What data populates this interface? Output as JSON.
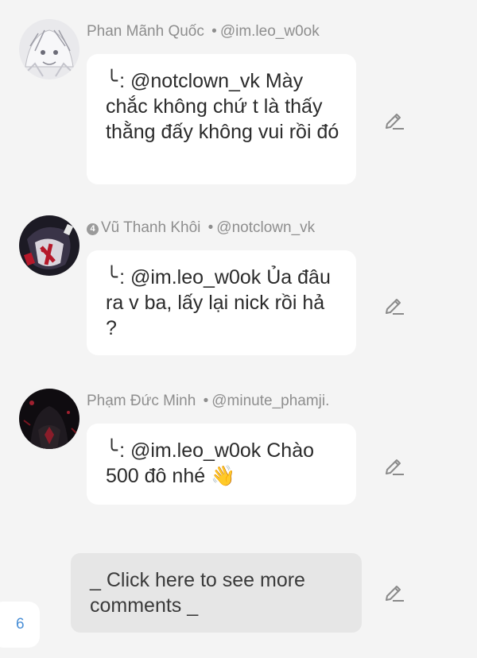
{
  "comments": [
    {
      "author": "Phan Mãnh Quốc",
      "handle": "@im.leo_w0ok",
      "separator": "•",
      "reply_arrow": "╰",
      "text": ": @notclown_vk Mày chắc không chứ t là thấy thằng đấy không vui rồi đó",
      "avatar_icon": "white-haired-character-avatar"
    },
    {
      "badge": "4",
      "author": "Vũ Thanh Khôi",
      "handle": "@notclown_vk",
      "separator": "•",
      "reply_arrow": "╰",
      "text": ": @im.leo_w0ok Ủa đâu ra v ba, lấy lại nick rồi hả ?",
      "avatar_icon": "dark-red-character-avatar"
    },
    {
      "author": "Phạm Đức Minh",
      "handle": "@minute_phamji.",
      "separator": "•",
      "reply_arrow": "╰",
      "text": ": @im.leo_w0ok Chào 500 đô nhé 👋",
      "avatar_icon": "dark-hooded-character-avatar"
    }
  ],
  "more_comments": {
    "label": "_ Click here to see more comments _"
  },
  "page_number": "6",
  "colors": {
    "background": "#f4f4f4",
    "bubble": "#ffffff",
    "more_button": "#e6e6e6",
    "meta_text": "#8e8e8e",
    "page_number": "#4a8fd6"
  }
}
